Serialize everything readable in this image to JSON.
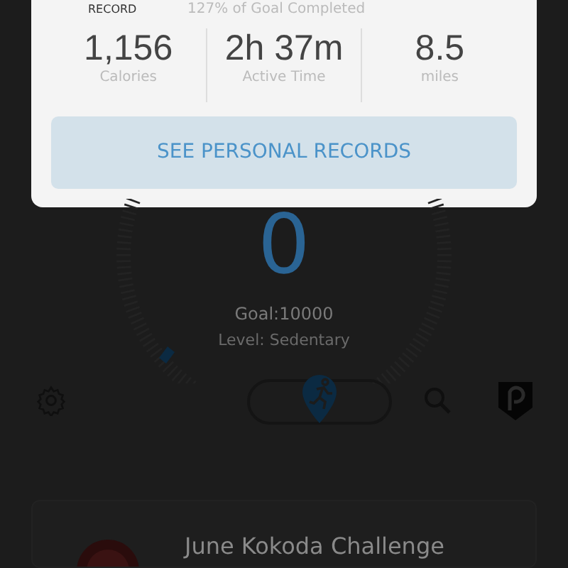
{
  "modal": {
    "record_label": "RECORD",
    "goal_progress": "127% of Goal Completed",
    "stats": [
      {
        "value": "1,156",
        "label": "Calories"
      },
      {
        "value": "2h 37m",
        "label": "Active Time"
      },
      {
        "value": "8.5",
        "label": "miles"
      }
    ],
    "button": "SEE PERSONAL RECORDS"
  },
  "steps": {
    "count": "0",
    "goal": "Goal:10000",
    "level": "Level: Sedentary"
  },
  "challenge": {
    "title": "June Kokoda Challenge"
  }
}
